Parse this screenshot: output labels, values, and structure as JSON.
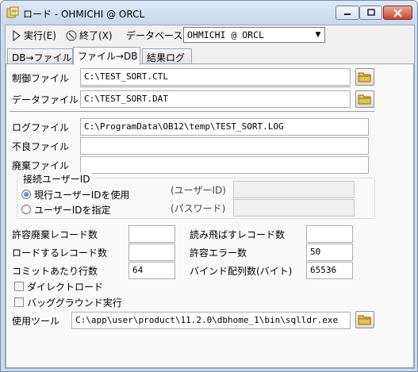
{
  "window": {
    "title": "ロード - OHMICHI @ ORCL",
    "minimize_icon": "minimize-icon",
    "maximize_icon": "maximize-icon",
    "close_icon": "close-icon"
  },
  "toolbar": {
    "execute_label": "実行(E)",
    "exit_label": "終了(X)",
    "database_label": "データベース",
    "database_value": "OHMICHI @ ORCL"
  },
  "tabs": [
    {
      "label": "DB→ファイル",
      "active": false
    },
    {
      "label": "ファイル→DB",
      "active": true
    },
    {
      "label": "結果ログ",
      "active": false
    }
  ],
  "form": {
    "control_file_label": "制御ファイル",
    "control_file_value": "C:\\TEST_SORT.CTL",
    "data_file_label": "データファイル",
    "data_file_value": "C:\\TEST_SORT.DAT",
    "log_file_label": "ログファイル",
    "log_file_value": "C:\\ProgramData\\OB12\\temp\\TEST_SORT.LOG",
    "bad_file_label": "不良ファイル",
    "bad_file_value": "",
    "discard_file_label": "廃棄ファイル",
    "discard_file_value": ""
  },
  "connect_user": {
    "group_title": "接続ユーザーID",
    "use_current_label": "現行ユーザーIDを使用",
    "specify_label": "ユーザーIDを指定",
    "user_id_label": "(ユーザーID)",
    "user_id_value": "",
    "password_label": "(パスワード)",
    "password_value": "",
    "selected": "use_current"
  },
  "options": {
    "allowed_discard_label": "許容廃棄レコード数",
    "allowed_discard_value": "",
    "skip_records_label": "読み飛ばすレコード数",
    "skip_records_value": "",
    "load_records_label": "ロードするレコード数",
    "load_records_value": "",
    "allowed_errors_label": "許容エラー数",
    "allowed_errors_value": "50",
    "commit_rows_label": "コミットあたり行数",
    "commit_rows_value": "64",
    "bind_array_label": "バインド配列数(バイト)",
    "bind_array_value": "65536",
    "direct_load_label": "ダイレクトロード",
    "direct_load_checked": false,
    "background_label": "バッググラウンド実行",
    "background_checked": false,
    "tool_label": "使用ツール",
    "tool_value": "C:\\app\\user\\product\\11.2.0\\dbhome_1\\bin\\sqlldr.exe"
  },
  "colors": {
    "title_bar": "#c9dbef",
    "close_button": "#c8452c",
    "panel_bg": "#f9f9f9",
    "folder_icon": "#e8c24a"
  }
}
